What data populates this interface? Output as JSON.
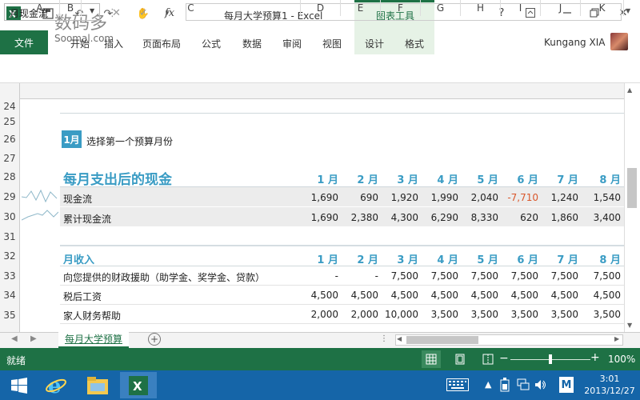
{
  "window": {
    "title": "每月大学预算1 - Excel",
    "chart_tools": "图表工具",
    "help": "?",
    "user": "Kungang XIA"
  },
  "watermark": {
    "main": "数码多",
    "sub": "Soomal.com"
  },
  "ribbon": {
    "file": "文件",
    "tabs": [
      "开始",
      "插入",
      "页面布局",
      "公式",
      "数据",
      "审阅",
      "视图",
      "设计",
      "格式"
    ]
  },
  "formula_bar": {
    "name_box": "月现金流",
    "fx": "fx",
    "value": ""
  },
  "columns": [
    "A",
    "B",
    "C",
    "D",
    "E",
    "F",
    "G",
    "H",
    "I",
    "J",
    "K"
  ],
  "rows": [
    "24",
    "25",
    "26",
    "27",
    "28",
    "29",
    "30",
    "31",
    "32",
    "33",
    "34",
    "35"
  ],
  "sheet": {
    "month_chip": "1月",
    "month_prompt": "选择第一个预算月份",
    "cashflow_title": "每月支出后的现金",
    "income_title": "月收入",
    "months": [
      "1 月",
      "2 月",
      "3 月",
      "4 月",
      "5 月",
      "6 月",
      "7 月",
      "8 月"
    ],
    "cashflow_rows": [
      {
        "label": "现金流",
        "values": [
          "1,690",
          "690",
          "1,920",
          "1,990",
          "2,040",
          "-7,710",
          "1,240",
          "1,540"
        ]
      },
      {
        "label": "累计现金流",
        "values": [
          "1,690",
          "2,380",
          "4,300",
          "6,290",
          "8,330",
          "620",
          "1,860",
          "3,400"
        ]
      }
    ],
    "income_rows": [
      {
        "label": "向您提供的财政援助（助学金、奖学金、贷款）",
        "values": [
          "-",
          "-",
          "7,500",
          "7,500",
          "7,500",
          "7,500",
          "7,500",
          "7,500"
        ]
      },
      {
        "label": "税后工资",
        "values": [
          "4,500",
          "4,500",
          "4,500",
          "4,500",
          "4,500",
          "4,500",
          "4,500",
          "4,500"
        ]
      },
      {
        "label": "家人财务帮助",
        "values": [
          "2,000",
          "2,000",
          "10,000",
          "3,500",
          "3,500",
          "3,500",
          "3,500",
          "3,500"
        ]
      }
    ],
    "tab_name": "每月大学预算"
  },
  "status": {
    "ready": "就绪",
    "zoom": "100%",
    "zoom_level": 100
  },
  "taskbar": {
    "time": "3:01",
    "date": "2013/12/27",
    "ime": "M"
  },
  "colors": {
    "excel_green": "#1e7145",
    "accent_blue": "#3a9cc4",
    "negative": "#d9572b",
    "taskbar": "#1565a8"
  }
}
